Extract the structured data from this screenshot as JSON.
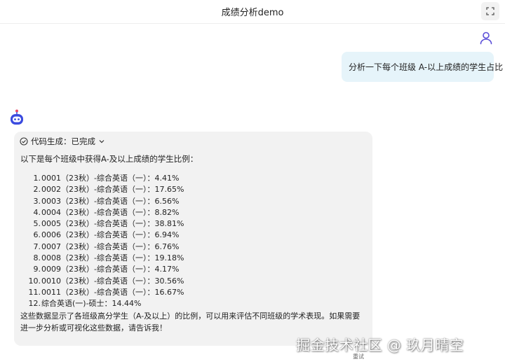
{
  "header": {
    "title": "成绩分析demo"
  },
  "user_message": {
    "text": "分析一下每个班级 A-以上成绩的学生占比"
  },
  "bot_message": {
    "status_label": "代码生成：已完成",
    "intro": "以下是每个班级中获得A-及以上成绩的学生比例：",
    "items": [
      {
        "num": "1.",
        "text": "0001（23秋）-综合英语（一）：4.41%"
      },
      {
        "num": "2.",
        "text": "0002（23秋）-综合英语（一）：17.65%"
      },
      {
        "num": "3.",
        "text": "0003（23秋）-综合英语（一）：6.56%"
      },
      {
        "num": "4.",
        "text": "0004（23秋）-综合英语（一）：8.82%"
      },
      {
        "num": "5.",
        "text": "0005（23秋）-综合英语（一）：38.81%"
      },
      {
        "num": "6.",
        "text": "0006（23秋）-综合英语（一）：6.94%"
      },
      {
        "num": "7.",
        "text": "0007（23秋）-综合英语（一）：6.76%"
      },
      {
        "num": "8.",
        "text": "0008（23秋）-综合英语（一）：19.18%"
      },
      {
        "num": "9.",
        "text": "0009（23秋）-综合英语（一）：4.17%"
      },
      {
        "num": "10.",
        "text": "0010（23秋）-综合英语（一）：30.56%"
      },
      {
        "num": "11.",
        "text": "0011（23秋）-综合英语（一）：16.67%"
      },
      {
        "num": "12.",
        "text": "综合英语(一)-硕士：14.44%"
      }
    ],
    "summary": "这些数据显示了各班级高分学生（A-及以上）的比例，可以用来评估不同班级的学术表现。如果需要进一步分析或可视化这些数据，请告诉我！",
    "retry_label": "重试"
  },
  "watermark": "掘金技术社区 @ 玖月晴空",
  "icons": {
    "expand": "expand-icon",
    "user": "user-icon",
    "bot": "robot-icon",
    "status": "check-circle-icon",
    "chevron": "chevron-down-icon"
  },
  "colors": {
    "user_bubble": "#e6f4fa",
    "bot_bubble": "#f2f2f2",
    "accent": "#5b4fd8"
  }
}
